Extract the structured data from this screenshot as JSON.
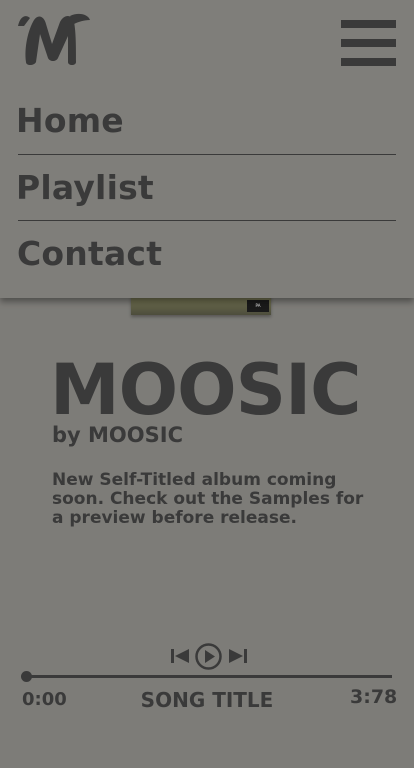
{
  "brand": {
    "logo_icon": "m-logo-icon"
  },
  "header": {
    "menu_icon": "hamburger-menu-icon"
  },
  "nav": {
    "items": [
      {
        "label": "Home"
      },
      {
        "label": "Playlist"
      },
      {
        "label": "Contact"
      }
    ]
  },
  "album": {
    "cover_icon": "album-cover-image",
    "advisory_label": "PARENTAL ADVISORY",
    "title": "MOOSIC",
    "artist": "by MOOSIC",
    "description": "New Self-Titled album coming soon. Check out the Samples for a preview before release."
  },
  "player": {
    "prev_icon": "skip-previous-icon",
    "play_icon": "play-icon",
    "next_icon": "skip-next-icon",
    "current_time": "0:00",
    "song_title": "SONG TITLE",
    "total_time": "3:78",
    "progress": 0
  },
  "colors": {
    "background": "#7d7c78",
    "text": "#3a3a3a"
  }
}
